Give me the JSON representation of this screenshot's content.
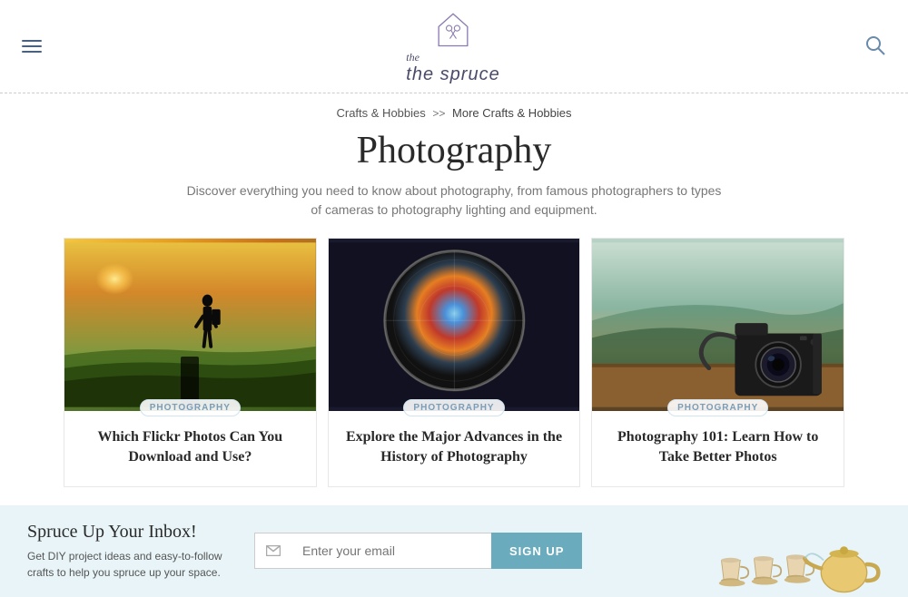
{
  "site": {
    "name": "the spruce",
    "tagline": "the"
  },
  "header": {
    "menu_label": "Menu",
    "search_label": "Search"
  },
  "breadcrumb": {
    "parent": "Crafts & Hobbies",
    "separator": ">>",
    "current": "More Crafts & Hobbies"
  },
  "page": {
    "title": "Photography",
    "subtitle": "Discover everything you need to know about photography, from famous photographers to types of cameras to photography lighting and equipment."
  },
  "articles": [
    {
      "tag": "PHOTOGRAPHY",
      "title": "Which Flickr Photos Can You Download and Use?",
      "img_type": "photo1"
    },
    {
      "tag": "PHOTOGRAPHY",
      "title": "Explore the Major Advances in the History of Photography",
      "img_type": "photo2"
    },
    {
      "tag": "PHOTOGRAPHY",
      "title": "Photography 101: Learn How to Take Better Photos",
      "img_type": "photo3"
    }
  ],
  "newsletter": {
    "title": "Spruce Up Your Inbox!",
    "description": "Get DIY project ideas and easy-to-follow crafts to help you spruce up your space.",
    "input_placeholder": "Enter your email",
    "button_label": "SIGN UP"
  }
}
